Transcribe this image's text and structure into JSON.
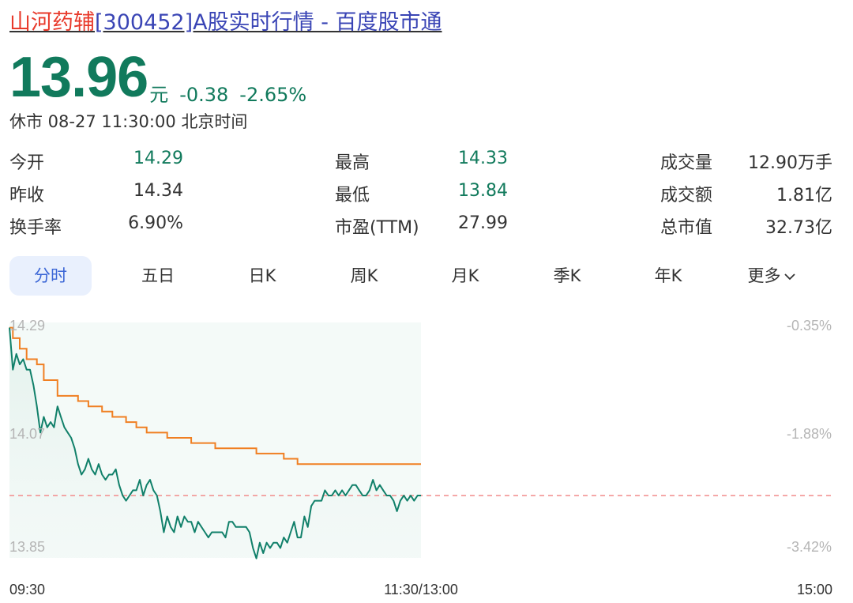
{
  "header": {
    "stock_name": "山河药辅",
    "title_rest": "[300452]A股实时行情 - 百度股市通"
  },
  "quote": {
    "price": "13.96",
    "unit": "元",
    "change": "-0.38",
    "change_pct": "-2.65%",
    "status": "休市 08-27 11:30:00 北京时间"
  },
  "stats": [
    {
      "label": "今开",
      "value": "14.29",
      "tone": "green"
    },
    {
      "label": "最高",
      "value": "14.33",
      "tone": "green"
    },
    {
      "label": "成交量",
      "value": "12.90万手",
      "tone": "dark"
    },
    {
      "label": "昨收",
      "value": "14.34",
      "tone": "dark"
    },
    {
      "label": "最低",
      "value": "13.84",
      "tone": "green"
    },
    {
      "label": "成交额",
      "value": "1.81亿",
      "tone": "dark"
    },
    {
      "label": "换手率",
      "value": "6.90%",
      "tone": "dark"
    },
    {
      "label": "市盈(TTM)",
      "value": "27.99",
      "tone": "dark"
    },
    {
      "label": "总市值",
      "value": "32.73亿",
      "tone": "dark"
    }
  ],
  "tabs": [
    {
      "label": "分时",
      "active": true
    },
    {
      "label": "五日",
      "active": false
    },
    {
      "label": "日K",
      "active": false
    },
    {
      "label": "周K",
      "active": false
    },
    {
      "label": "月K",
      "active": false
    },
    {
      "label": "季K",
      "active": false
    },
    {
      "label": "年K",
      "active": false
    },
    {
      "label": "更多",
      "active": false
    }
  ],
  "colors": {
    "price_line": "#11806a",
    "avg_line": "#f07f22",
    "prev_close_line": "#f28b8b",
    "down_green": "#117a5c"
  },
  "chart_data": {
    "type": "line",
    "title": "",
    "y_ticks": [
      "14.29",
      "14.07",
      "13.85"
    ],
    "y_right_ticks": [
      "-0.35%",
      "-1.88%",
      "-3.42%"
    ],
    "x_ticks": [
      "09:30",
      "11:30/13:00",
      "15:00"
    ],
    "ylim": [
      13.85,
      14.29
    ],
    "prev_close": 13.96,
    "total_minutes": 240,
    "series": [
      {
        "kind": "price",
        "x": [
          0,
          1,
          2,
          3,
          4,
          5,
          6,
          7,
          8,
          9,
          10,
          11,
          12,
          13,
          14,
          15,
          16,
          17,
          18,
          19,
          20,
          21,
          22,
          23,
          24,
          25,
          26,
          27,
          28,
          29,
          30,
          31,
          32,
          33,
          34,
          35,
          36,
          37,
          38,
          39,
          40,
          41,
          42,
          43,
          44,
          45,
          46,
          47,
          48,
          49,
          50,
          51,
          52,
          53,
          54,
          55,
          56,
          57,
          58,
          59,
          60,
          61,
          62,
          63,
          64,
          65,
          66,
          67,
          68,
          69,
          70,
          71,
          72,
          73,
          74,
          75,
          76,
          77,
          78,
          79,
          80,
          81,
          82,
          83,
          84,
          85,
          86,
          87,
          88,
          89,
          90,
          91,
          92,
          93,
          94,
          95,
          96,
          97,
          98,
          99,
          100,
          101,
          102,
          103,
          104,
          105,
          106,
          107,
          108,
          109,
          110,
          111,
          112,
          113,
          114,
          115,
          116,
          117,
          118,
          119,
          120
        ],
        "values": [
          14.28,
          14.2,
          14.23,
          14.21,
          14.22,
          14.2,
          14.2,
          14.17,
          14.13,
          14.08,
          14.11,
          14.09,
          14.1,
          14.09,
          14.13,
          14.11,
          14.09,
          14.08,
          14.07,
          14.05,
          14.02,
          14.0,
          14.01,
          14.03,
          14.01,
          14.0,
          14.02,
          14.0,
          13.99,
          14.0,
          14.0,
          14.01,
          13.98,
          13.96,
          13.95,
          13.96,
          13.97,
          13.97,
          13.99,
          13.96,
          13.98,
          13.99,
          13.97,
          13.96,
          13.93,
          13.89,
          13.92,
          13.9,
          13.89,
          13.92,
          13.9,
          13.92,
          13.91,
          13.91,
          13.89,
          13.91,
          13.9,
          13.89,
          13.88,
          13.89,
          13.89,
          13.89,
          13.89,
          13.88,
          13.91,
          13.91,
          13.9,
          13.9,
          13.9,
          13.9,
          13.89,
          13.86,
          13.84,
          13.87,
          13.85,
          13.87,
          13.86,
          13.87,
          13.87,
          13.86,
          13.88,
          13.87,
          13.89,
          13.91,
          13.88,
          13.88,
          13.92,
          13.9,
          13.94,
          13.95,
          13.95,
          13.95,
          13.97,
          13.96,
          13.96,
          13.97,
          13.96,
          13.97,
          13.96,
          13.97,
          13.98,
          13.98,
          13.97,
          13.96,
          13.96,
          13.97,
          13.99,
          13.97,
          13.98,
          13.97,
          13.96,
          13.96,
          13.95,
          13.93,
          13.95,
          13.96,
          13.95,
          13.96,
          13.95,
          13.96,
          13.96
        ]
      },
      {
        "kind": "average",
        "x": [
          0,
          1,
          3,
          5,
          8,
          10,
          14,
          20,
          23,
          27,
          30,
          34,
          37,
          40,
          43,
          46,
          50,
          53,
          56,
          60,
          65,
          69,
          72,
          76,
          80,
          84,
          90,
          100,
          110,
          120
        ],
        "values": [
          14.28,
          14.26,
          14.24,
          14.22,
          14.21,
          14.18,
          14.15,
          14.14,
          14.13,
          14.12,
          14.11,
          14.1,
          14.09,
          14.08,
          14.08,
          14.07,
          14.07,
          14.06,
          14.06,
          14.05,
          14.05,
          14.05,
          14.04,
          14.04,
          14.03,
          14.02,
          14.02,
          14.02,
          14.02,
          14.02
        ]
      }
    ]
  }
}
